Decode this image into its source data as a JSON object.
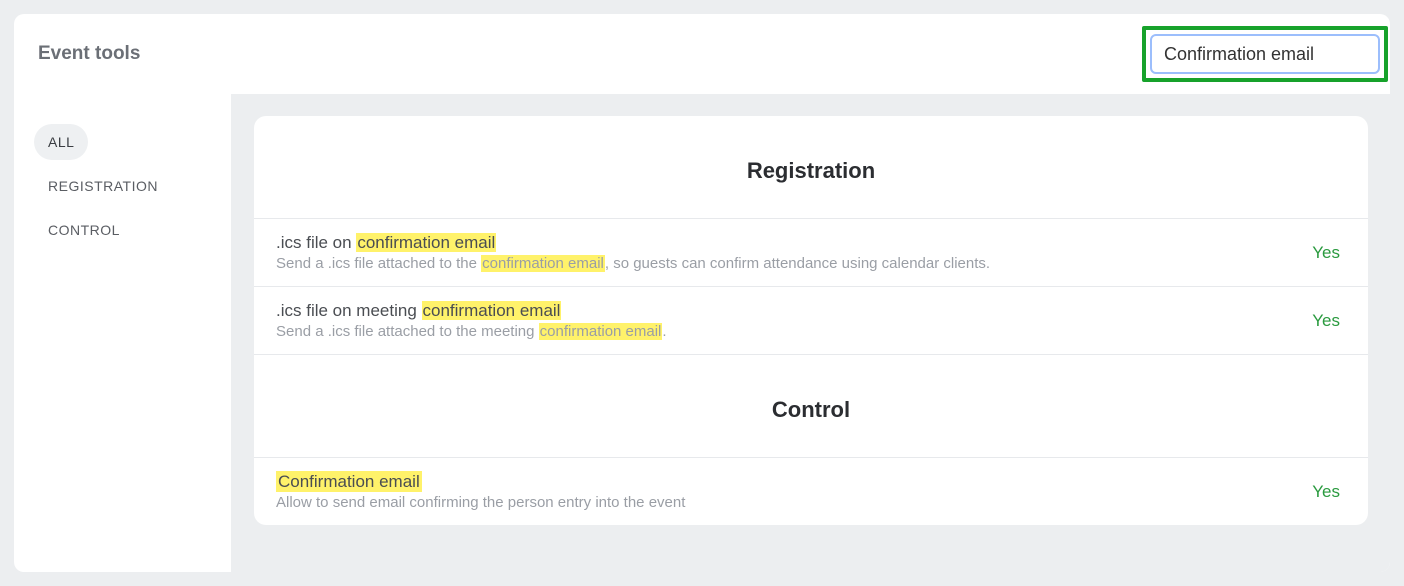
{
  "page_title": "Event tools",
  "search": {
    "value": "Confirmation email"
  },
  "sidebar": {
    "items": [
      {
        "label": "ALL",
        "active": true
      },
      {
        "label": "REGISTRATION",
        "active": false
      },
      {
        "label": "CONTROL",
        "active": false
      }
    ]
  },
  "sections": {
    "registration": {
      "heading": "Registration",
      "rows": [
        {
          "title_pre": ".ics file on ",
          "title_hl": "confirmation email",
          "title_post": "",
          "desc_pre": "Send a .ics file attached to the ",
          "desc_hl": "confirmation email",
          "desc_post": ", so guests can confirm attendance using calendar clients.",
          "value": "Yes"
        },
        {
          "title_pre": ".ics file on meeting ",
          "title_hl": "confirmation email",
          "title_post": "",
          "desc_pre": "Send a .ics file attached to the meeting ",
          "desc_hl": "confirmation email",
          "desc_post": ".",
          "value": "Yes"
        }
      ]
    },
    "control": {
      "heading": "Control",
      "rows": [
        {
          "title_pre": "",
          "title_hl": "Confirmation email",
          "title_post": "",
          "desc_pre": "Allow to send email confirming the person entry into the event",
          "desc_hl": "",
          "desc_post": "",
          "value": "Yes"
        }
      ]
    }
  }
}
